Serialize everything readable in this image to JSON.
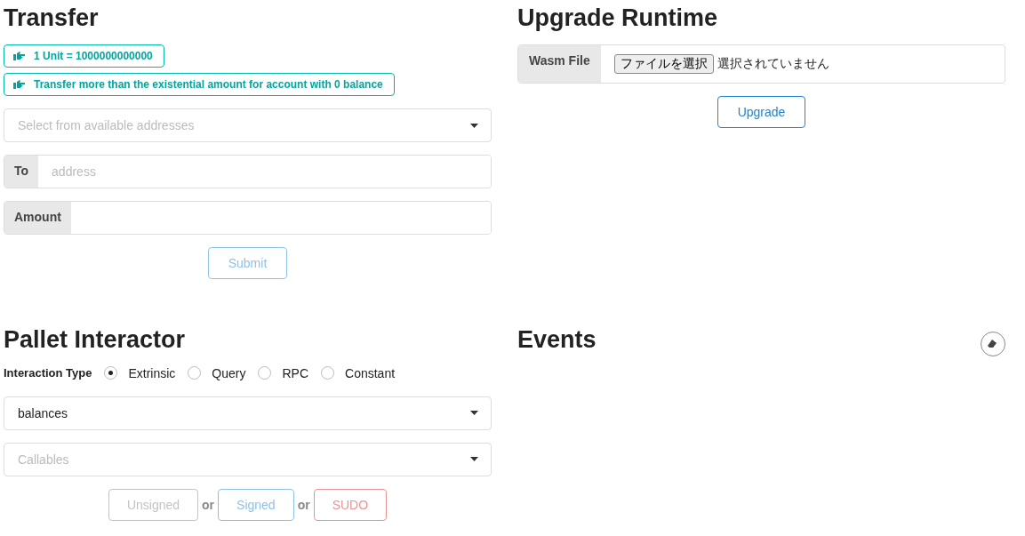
{
  "transfer": {
    "title": "Transfer",
    "notes": [
      "1 Unit = 1000000000000",
      "Transfer more than the existential amount for account with 0 balance"
    ],
    "from_select": {
      "placeholder": "Select from available addresses"
    },
    "to_field": {
      "label": "To",
      "placeholder": "address"
    },
    "amount_field": {
      "label": "Amount"
    },
    "submit": {
      "label": "Submit",
      "disabled": true
    }
  },
  "upgrade_runtime": {
    "title": "Upgrade Runtime",
    "file_field": {
      "label": "Wasm File",
      "button": "ファイルを選択",
      "status": "選択されていません"
    },
    "upgrade": {
      "label": "Upgrade",
      "disabled": false
    }
  },
  "pallet_interactor": {
    "title": "Pallet Interactor",
    "interaction_type": {
      "label": "Interaction Type",
      "options": [
        {
          "label": "Extrinsic",
          "selected": true
        },
        {
          "label": "Query",
          "selected": false
        },
        {
          "label": "RPC",
          "selected": false
        },
        {
          "label": "Constant",
          "selected": false
        }
      ]
    },
    "pallet_select": {
      "value": "balances"
    },
    "callable_select": {
      "placeholder": "Callables"
    },
    "sign_buttons": [
      {
        "label": "Unsigned",
        "kind": "unsigned",
        "disabled": true
      },
      {
        "label": "Signed",
        "kind": "signed",
        "disabled": true
      },
      {
        "label": "SUDO",
        "kind": "sudo",
        "disabled": true
      }
    ],
    "separators": [
      "or",
      "or"
    ]
  },
  "events": {
    "title": "Events"
  }
}
